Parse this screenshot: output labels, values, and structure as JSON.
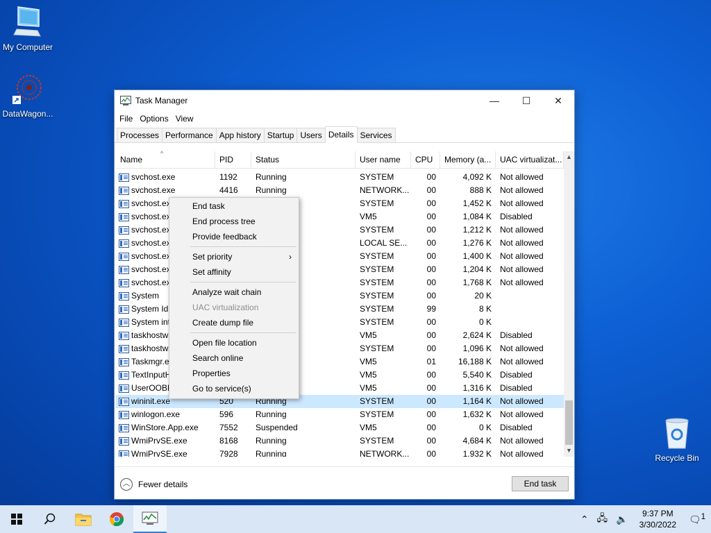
{
  "desktop": {
    "icons": [
      {
        "label": "My Computer"
      },
      {
        "label": "DataWagon..."
      },
      {
        "label": "Recycle Bin"
      }
    ]
  },
  "window": {
    "title": "Task Manager",
    "controls": {
      "minimize": "—",
      "maximize": "☐",
      "close": "✕"
    },
    "menu": [
      "File",
      "Options",
      "View"
    ],
    "tabs": [
      "Processes",
      "Performance",
      "App history",
      "Startup",
      "Users",
      "Details",
      "Services"
    ],
    "active_tab": "Details",
    "columns": [
      "Name",
      "PID",
      "Status",
      "User name",
      "CPU",
      "Memory (a...",
      "UAC virtualizat..."
    ],
    "rows": [
      {
        "name": "svchost.exe",
        "pid": "1192",
        "status": "Running",
        "user": "SYSTEM",
        "cpu": "00",
        "mem": "4,092 K",
        "uac": "Not allowed"
      },
      {
        "name": "svchost.exe",
        "pid": "4416",
        "status": "Running",
        "user": "NETWORK...",
        "cpu": "00",
        "mem": "888 K",
        "uac": "Not allowed"
      },
      {
        "name": "svchost.ex",
        "pid": "",
        "status": "",
        "user": "SYSTEM",
        "cpu": "00",
        "mem": "1,452 K",
        "uac": "Not allowed"
      },
      {
        "name": "svchost.ex",
        "pid": "",
        "status": "",
        "user": "VM5",
        "cpu": "00",
        "mem": "1,084 K",
        "uac": "Disabled"
      },
      {
        "name": "svchost.ex",
        "pid": "",
        "status": "",
        "user": "SYSTEM",
        "cpu": "00",
        "mem": "1,212 K",
        "uac": "Not allowed"
      },
      {
        "name": "svchost.ex",
        "pid": "",
        "status": "",
        "user": "LOCAL SE...",
        "cpu": "00",
        "mem": "1,276 K",
        "uac": "Not allowed"
      },
      {
        "name": "svchost.ex",
        "pid": "",
        "status": "",
        "user": "SYSTEM",
        "cpu": "00",
        "mem": "1,400 K",
        "uac": "Not allowed"
      },
      {
        "name": "svchost.ex",
        "pid": "",
        "status": "",
        "user": "SYSTEM",
        "cpu": "00",
        "mem": "1,204 K",
        "uac": "Not allowed"
      },
      {
        "name": "svchost.ex",
        "pid": "",
        "status": "",
        "user": "SYSTEM",
        "cpu": "00",
        "mem": "1,768 K",
        "uac": "Not allowed"
      },
      {
        "name": "System",
        "pid": "",
        "status": "",
        "user": "SYSTEM",
        "cpu": "00",
        "mem": "20 K",
        "uac": ""
      },
      {
        "name": "System Idl",
        "pid": "",
        "status": "",
        "user": "SYSTEM",
        "cpu": "99",
        "mem": "8 K",
        "uac": ""
      },
      {
        "name": "System int",
        "pid": "",
        "status": "",
        "user": "SYSTEM",
        "cpu": "00",
        "mem": "0 K",
        "uac": ""
      },
      {
        "name": "taskhostw.",
        "pid": "",
        "status": "",
        "user": "VM5",
        "cpu": "00",
        "mem": "2,624 K",
        "uac": "Disabled"
      },
      {
        "name": "taskhostw.",
        "pid": "",
        "status": "",
        "user": "SYSTEM",
        "cpu": "00",
        "mem": "1,096 K",
        "uac": "Not allowed"
      },
      {
        "name": "Taskmgr.ex",
        "pid": "",
        "status": "",
        "user": "VM5",
        "cpu": "01",
        "mem": "16,188 K",
        "uac": "Not allowed"
      },
      {
        "name": "TextInputH",
        "pid": "",
        "status": "",
        "user": "VM5",
        "cpu": "00",
        "mem": "5,540 K",
        "uac": "Disabled"
      },
      {
        "name": "UserOOBE",
        "pid": "",
        "status": "",
        "user": "VM5",
        "cpu": "00",
        "mem": "1,316 K",
        "uac": "Disabled"
      },
      {
        "name": "wininit.exe",
        "pid": "520",
        "status": "Running",
        "user": "SYSTEM",
        "cpu": "00",
        "mem": "1,164 K",
        "uac": "Not allowed"
      },
      {
        "name": "winlogon.exe",
        "pid": "596",
        "status": "Running",
        "user": "SYSTEM",
        "cpu": "00",
        "mem": "1,632 K",
        "uac": "Not allowed"
      },
      {
        "name": "WinStore.App.exe",
        "pid": "7552",
        "status": "Suspended",
        "user": "VM5",
        "cpu": "00",
        "mem": "0 K",
        "uac": "Disabled"
      },
      {
        "name": "WmiPrvSE.exe",
        "pid": "8168",
        "status": "Running",
        "user": "SYSTEM",
        "cpu": "00",
        "mem": "4,684 K",
        "uac": "Not allowed"
      },
      {
        "name": "WmiPrvSE.exe",
        "pid": "7928",
        "status": "Running",
        "user": "NETWORK...",
        "cpu": "00",
        "mem": "1,932 K",
        "uac": "Not allowed"
      }
    ],
    "selected_row_index": 17,
    "footer": {
      "fewer_details": "Fewer details",
      "end_task": "End task"
    }
  },
  "context_menu": {
    "groups": [
      [
        {
          "label": "End task"
        },
        {
          "label": "End process tree"
        },
        {
          "label": "Provide feedback"
        }
      ],
      [
        {
          "label": "Set priority",
          "submenu": true
        },
        {
          "label": "Set affinity"
        }
      ],
      [
        {
          "label": "Analyze wait chain"
        },
        {
          "label": "UAC virtualization",
          "disabled": true
        },
        {
          "label": "Create dump file"
        }
      ],
      [
        {
          "label": "Open file location"
        },
        {
          "label": "Search online"
        },
        {
          "label": "Properties"
        },
        {
          "label": "Go to service(s)"
        }
      ]
    ]
  },
  "taskbar": {
    "clock_time": "9:37 PM",
    "clock_date": "3/30/2022",
    "notification_count": "1"
  }
}
